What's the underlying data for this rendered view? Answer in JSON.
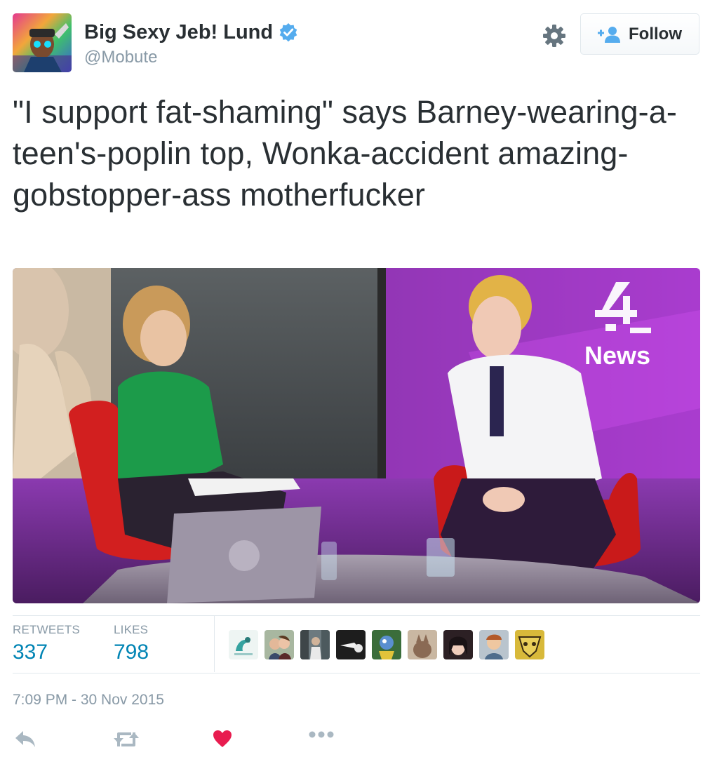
{
  "author": {
    "display_name": "Big Sexy Jeb! Lund",
    "handle": "@Mobute",
    "verified": true,
    "verified_color": "#55acee"
  },
  "header": {
    "settings_icon": "gear-icon",
    "follow_label": "Follow",
    "follow_icon": "person-add-icon",
    "follow_icon_color": "#55acee"
  },
  "tweet": {
    "text": "\"I support fat-shaming\" says Barney-wearing-a-teen's-poplin top, Wonka-accident amazing-gobstopper-ass motherfucker"
  },
  "media": {
    "logo_text": "News"
  },
  "stats": {
    "retweets_label": "RETWEETS",
    "retweets_value": "337",
    "likes_label": "LIKES",
    "likes_value": "798",
    "value_color": "#0084b4"
  },
  "likers": {
    "count": 9
  },
  "timestamp": "7:09 PM - 30 Nov 2015",
  "actions": {
    "reply_icon": "reply-icon",
    "retweet_icon": "retweet-icon",
    "like_icon": "heart-icon",
    "like_color": "#e81c4f",
    "more_icon": "more-dots-icon"
  }
}
